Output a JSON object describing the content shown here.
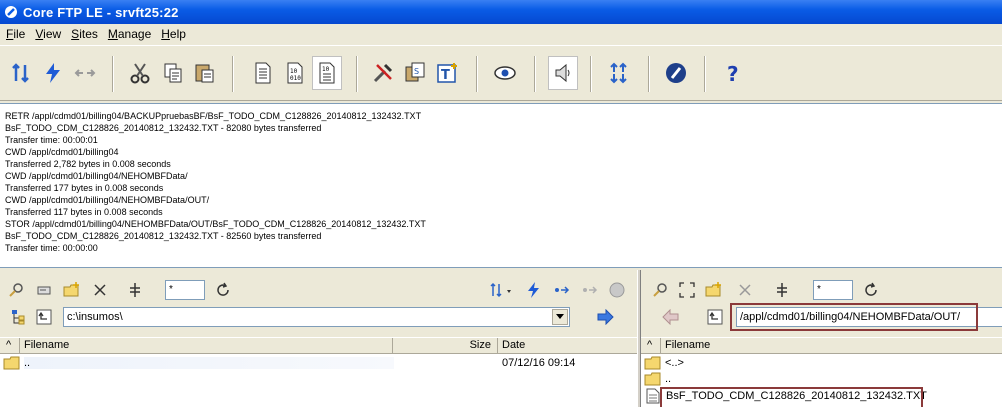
{
  "window": {
    "title": "Core FTP LE - srvft25:22"
  },
  "menu": [
    {
      "label": "File",
      "accel": "F",
      "rest": "ile"
    },
    {
      "label": "View",
      "accel": "V",
      "rest": "iew"
    },
    {
      "label": "Sites",
      "accel": "S",
      "rest": "ites"
    },
    {
      "label": "Manage",
      "accel": "M",
      "rest": "anage"
    },
    {
      "label": "Help",
      "accel": "H",
      "rest": "elp"
    }
  ],
  "toolbar_icons": [
    "connect-icon",
    "quick-connect-icon",
    "disconnect-icon",
    "cut-icon",
    "copy-icon",
    "paste-icon",
    "ascii-mode-icon",
    "binary-mode-icon",
    "auto-mode-icon",
    "settings-icon",
    "site-manager-icon",
    "terminal-icon",
    "view-icon",
    "sound-icon",
    "transfer-queue-icon",
    "about-icon",
    "help-icon"
  ],
  "log": [
    "RETR /appl/cdmd01/billing04/BACKUPpruebasBF/BsF_TODO_CDM_C128826_20140812_132432.TXT",
    "BsF_TODO_CDM_C128826_20140812_132432.TXT - 82080 bytes transferred",
    "Transfer time: 00:00:01",
    "CWD /appl/cdmd01/billing04",
    "Transferred 2,782 bytes in 0.008 seconds",
    "CWD /appl/cdmd01/billing04/NEHOMBFData/",
    "Transferred 177 bytes in 0.008 seconds",
    "CWD /appl/cdmd01/billing04/NEHOMBFData/OUT/",
    "Transferred 117 bytes in 0.008 seconds",
    "STOR /appl/cdmd01/billing04/NEHOMBFData/OUT/BsF_TODO_CDM_C128826_20140812_132432.TXT",
    "BsF_TODO_CDM_C128826_20140812_132432.TXT - 82560 bytes transferred",
    "Transfer time: 00:00:00"
  ],
  "local": {
    "filter": "*",
    "path": "c:\\insumos\\",
    "columns": {
      "sort": "^",
      "filename": "Filename",
      "size": "Size",
      "date": "Date"
    },
    "rows": [
      {
        "name": "..",
        "size": "",
        "date": "07/12/16  09:14"
      }
    ]
  },
  "remote": {
    "filter": "*",
    "path": "/appl/cdmd01/billing04/NEHOMBFData/OUT/",
    "columns": {
      "sort": "^",
      "filename": "Filename"
    },
    "rows": [
      {
        "name": "<..>",
        "type": "folder"
      },
      {
        "name": "..",
        "type": "folder"
      },
      {
        "name": "BsF_TODO_CDM_C128826_20140812_132432.TXT",
        "type": "file"
      }
    ]
  },
  "colors": {
    "title_blue": "#0a5ce6",
    "highlight": "#8b3a3a",
    "face": "#ece9d8"
  }
}
